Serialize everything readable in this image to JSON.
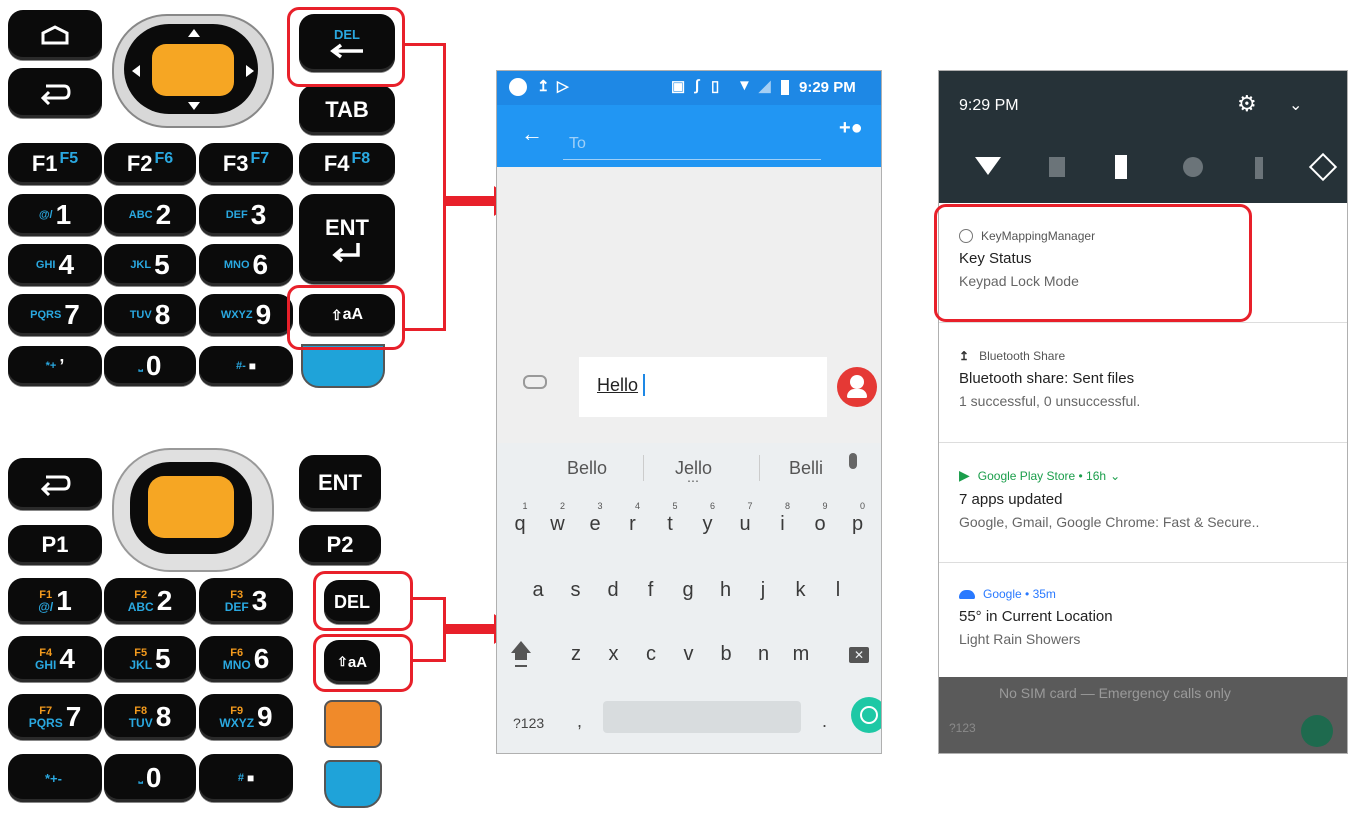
{
  "keypad_top": {
    "rows": [
      [
        "F1",
        "F2",
        "F3",
        "F4"
      ],
      [
        "1",
        "2",
        "3"
      ],
      [
        "4",
        "5",
        "6"
      ],
      [
        "7",
        "8",
        "9"
      ]
    ],
    "f_labels": [
      "F1",
      "F2",
      "F3",
      "F4"
    ],
    "f_sub": [
      "F5",
      "F6",
      "F7",
      "F8"
    ],
    "del_label": "DEL",
    "tab_label": "TAB",
    "ent_label": "ENT",
    "shift_label": "aA",
    "alpha": [
      "@/",
      "ABC",
      "DEF",
      "GHI",
      "JKL",
      "MNO",
      "PQRS",
      "TUV",
      "WXYZ"
    ],
    "digits": [
      "1",
      "2",
      "3",
      "4",
      "5",
      "6",
      "7",
      "8",
      "9"
    ],
    "bottom": [
      "*+",
      "0",
      "#-"
    ]
  },
  "keypad_bottom": {
    "ent_label": "ENT",
    "p1_label": "P1",
    "p2_label": "P2",
    "del_label": "DEL",
    "shift_label": "aA",
    "f_top": [
      "F1",
      "F2",
      "F3",
      "F4",
      "F5",
      "F6",
      "F7",
      "F8",
      "F9"
    ],
    "alpha": [
      "@/",
      "ABC",
      "DEF",
      "GHI",
      "JKL",
      "MNO",
      "PQRS",
      "TUV",
      "WXYZ"
    ],
    "digits": [
      "1",
      "2",
      "3",
      "4",
      "5",
      "6",
      "7",
      "8",
      "9"
    ],
    "bottom": [
      "*+-",
      "0",
      "#"
    ]
  },
  "phone1": {
    "time": "9:29 PM",
    "to_placeholder": "To",
    "message": "Hello",
    "suggestions": [
      "Bello",
      "Jello",
      "Belli"
    ],
    "row1": [
      "q",
      "w",
      "e",
      "r",
      "t",
      "y",
      "u",
      "i",
      "o",
      "p"
    ],
    "row1_nums": [
      "1",
      "2",
      "3",
      "4",
      "5",
      "6",
      "7",
      "8",
      "9",
      "0"
    ],
    "row2": [
      "a",
      "s",
      "d",
      "f",
      "g",
      "h",
      "j",
      "k",
      "l"
    ],
    "row3": [
      "z",
      "x",
      "c",
      "v",
      "b",
      "n",
      "m"
    ],
    "symbols_key": "?123",
    "comma": ",",
    "period": "."
  },
  "phone2": {
    "time": "9:29 PM",
    "notifications": [
      {
        "app": "KeyMappingManager",
        "title": "Key Status",
        "text": "Keypad Lock Mode"
      },
      {
        "app": "Bluetooth Share",
        "title": "Bluetooth share: Sent files",
        "text": "1 successful, 0 unsuccessful."
      },
      {
        "app": "Google Play Store",
        "meta": "• 16h",
        "title": "7 apps updated",
        "text": "Google, Gmail, Google Chrome: Fast & Secure.."
      },
      {
        "app": "Google",
        "meta": "• 35m",
        "title": "55° in Current Location",
        "text": "Light Rain Showers"
      }
    ],
    "footer": "No SIM card — Emergency calls only",
    "footer_key": "?123"
  },
  "colors": {
    "accent_red": "#e8202a",
    "status_blue": "#1e88e5",
    "appbar_blue": "#2196f3",
    "nav_orange": "#f6a623"
  }
}
